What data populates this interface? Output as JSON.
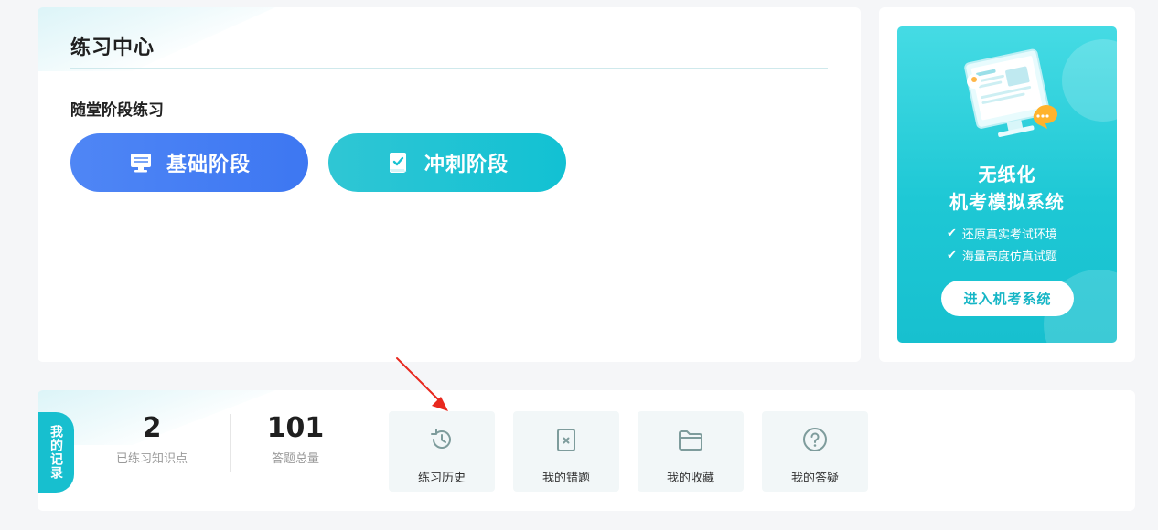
{
  "practice": {
    "title": "练习中心",
    "section_label": "随堂阶段练习",
    "buttons": [
      {
        "label": "基础阶段",
        "icon": "monitor-icon"
      },
      {
        "label": "冲刺阶段",
        "icon": "scroll-check-icon"
      }
    ]
  },
  "ad": {
    "headline_line1": "无纸化",
    "headline_line2": "机考模拟系统",
    "points": [
      "还原真实考试环境",
      "海量高度仿真试题"
    ],
    "cta_label": "进入机考系统",
    "illustration": "computer-exam-illustration"
  },
  "records": {
    "tag_label": "我的记录",
    "stats": [
      {
        "value": "2",
        "label": "已练习知识点"
      },
      {
        "value": "101",
        "label": "答题总量"
      }
    ],
    "tiles": [
      {
        "label": "练习历史",
        "icon": "history-clock-icon"
      },
      {
        "label": "我的错题",
        "icon": "error-book-icon"
      },
      {
        "label": "我的收藏",
        "icon": "folder-icon"
      },
      {
        "label": "我的答疑",
        "icon": "question-circle-icon"
      }
    ]
  },
  "colors": {
    "basic_button": "#3d77f2",
    "sprint_button": "#12c1d3",
    "accent": "#17bfcf",
    "annotation_arrow": "#e8281e"
  }
}
